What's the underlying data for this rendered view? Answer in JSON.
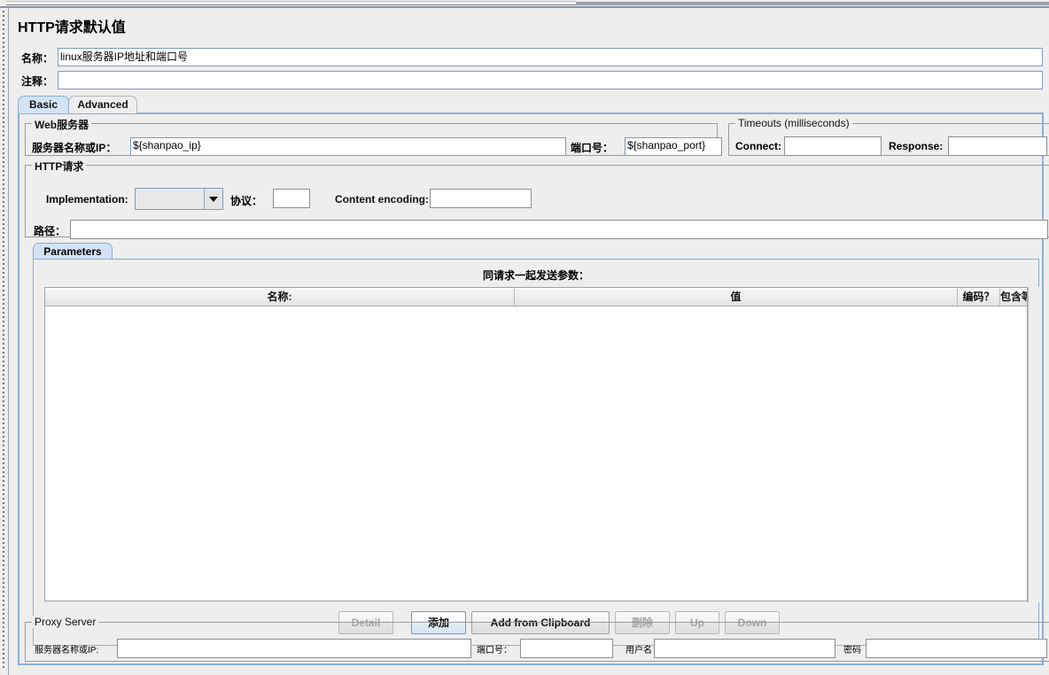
{
  "window": {
    "title": "HTTP请求默认值"
  },
  "header": {
    "name_label": "名称：",
    "name_value": "linux服务器IP地址和端口号",
    "comment_label": "注释：",
    "comment_value": ""
  },
  "tabs": [
    {
      "label": "Basic",
      "selected": true
    },
    {
      "label": "Advanced",
      "selected": false
    }
  ],
  "web_server": {
    "group_title": "Web服务器",
    "host_label": "服务器名称或IP：",
    "host_value": "${shanpao_ip}",
    "port_label": "端口号：",
    "port_value": "${shanpao_port}"
  },
  "timeouts": {
    "group_title": "Timeouts (milliseconds)",
    "connect_label": "Connect:",
    "connect_value": "",
    "response_label": "Response:",
    "response_value": ""
  },
  "http_request": {
    "group_title": "HTTP请求",
    "implementation_label": "Implementation:",
    "implementation_value": "",
    "protocol_label": "协议：",
    "protocol_value": "",
    "content_encoding_label": "Content encoding:",
    "content_encoding_value": "",
    "path_label": "路径：",
    "path_value": ""
  },
  "parameters": {
    "tab_label": "Parameters",
    "caption": "同请求一起发送参数：",
    "columns": [
      "名称:",
      "值",
      "编码？",
      "包含等于？"
    ],
    "rows": [],
    "buttons": [
      {
        "label": "Detail",
        "enabled": false,
        "focused": false
      },
      {
        "label": "添加",
        "enabled": true,
        "focused": true
      },
      {
        "label": "Add from Clipboard",
        "enabled": true,
        "focused": false
      },
      {
        "label": "删除",
        "enabled": false,
        "focused": false
      },
      {
        "label": "Up",
        "enabled": false,
        "focused": false
      },
      {
        "label": "Down",
        "enabled": false,
        "focused": false
      }
    ]
  },
  "proxy_server": {
    "group_title": "Proxy Server",
    "host_label": "服务器名称或IP:",
    "host_value": "",
    "port_label": "端口号：",
    "port_value": "",
    "username_label": "用户名",
    "username_value": "",
    "password_label": "密码",
    "password_value": ""
  },
  "colors": {
    "background": "#eeeeee",
    "tab_selected": "#d3e3f5",
    "panel_border": "#8fafd0",
    "field_border": "#7f99b8"
  }
}
